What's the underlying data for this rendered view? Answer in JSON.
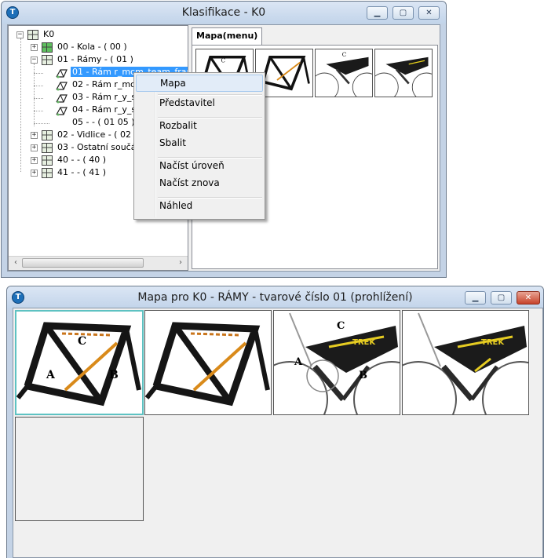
{
  "window1": {
    "title": "Klasifikace - K0",
    "tree": [
      {
        "label": "K0",
        "icon": "grid-root"
      },
      {
        "label": "00 - Kola - ( 00 )",
        "icon": "grid-green"
      },
      {
        "label": "01 - Rámy - ( 01 )",
        "icon": "grid"
      },
      {
        "label": "01 - Rám r_mcm_team_frame",
        "icon": "bike-frame"
      },
      {
        "label": "02 - Rám r_mcm",
        "icon": "bike-frame"
      },
      {
        "label": "03 - Rám r_y_sl",
        "icon": "bike-frame"
      },
      {
        "label": "04 - Rám r_y_sl",
        "icon": "bike-frame"
      },
      {
        "label": "05 -  - ( 01 05 )",
        "icon": "none"
      },
      {
        "label": "02 - Vidlice - ( 02 )",
        "icon": "grid"
      },
      {
        "label": "03 - Ostatní součás",
        "icon": "grid"
      },
      {
        "label": "40 -  - ( 40 )",
        "icon": "grid"
      },
      {
        "label": "41 -  - ( 41 )",
        "icon": "grid"
      }
    ],
    "tab_label": "Mapa(menu)",
    "thumbnails": [
      "bike-frame-giant-labeled",
      "bike-frame-giant",
      "bike-frame-trek-labeled",
      "bike-frame-trek"
    ]
  },
  "context_menu": {
    "items": [
      "Mapa",
      "Představitel",
      "Rozbalit",
      "Sbalit",
      "Načíst úroveň",
      "Načíst znova",
      "Náhled"
    ],
    "highlighted": "Mapa"
  },
  "window2": {
    "title": "Mapa pro K0 - RÁMY - tvarové číslo 01 (prohlížení)",
    "thumb_labels": [
      "A",
      "B",
      "C"
    ],
    "thumbnails": [
      "bike-frame-giant-labeled",
      "bike-frame-giant",
      "bike-frame-trek-labeled",
      "bike-frame-trek",
      "empty"
    ]
  },
  "icons": {
    "app": "app-logo-icon",
    "minimize": "minimize-icon",
    "maximize": "maximize-icon",
    "close": "close-icon"
  },
  "colors": {
    "title_bar": "#c2d4ea",
    "selection": "#3399ff",
    "menu_hover": "#e2ecf8",
    "selected_thumb_border": "#5ec2c2",
    "close_button": "#c7432b"
  }
}
